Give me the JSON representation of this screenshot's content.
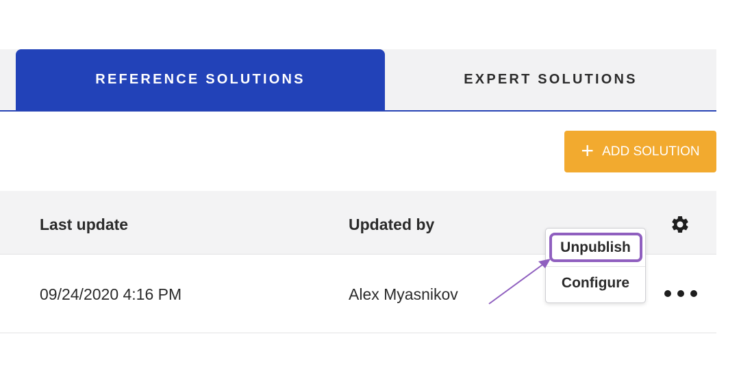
{
  "tabs": {
    "reference": "REFERENCE SOLUTIONS",
    "expert": "EXPERT SOLUTIONS"
  },
  "toolbar": {
    "add_plus": "+",
    "add_label": "ADD SOLUTION"
  },
  "table": {
    "headers": {
      "last_update": "Last update",
      "updated_by": "Updated by"
    },
    "rows": [
      {
        "last_update": "09/24/2020 4:16 PM",
        "updated_by": "Alex Myasnikov"
      }
    ]
  },
  "menu": {
    "items": [
      "Unpublish",
      "Configure"
    ]
  },
  "icons": {
    "settings": "gear-icon",
    "row_actions": "more-horizontal-icon",
    "add": "plus-icon",
    "annotation": "arrow-annotation"
  },
  "colors": {
    "tab_active": "#2242b8",
    "add_button": "#f2aa2f",
    "highlight": "#8f5fbf"
  }
}
